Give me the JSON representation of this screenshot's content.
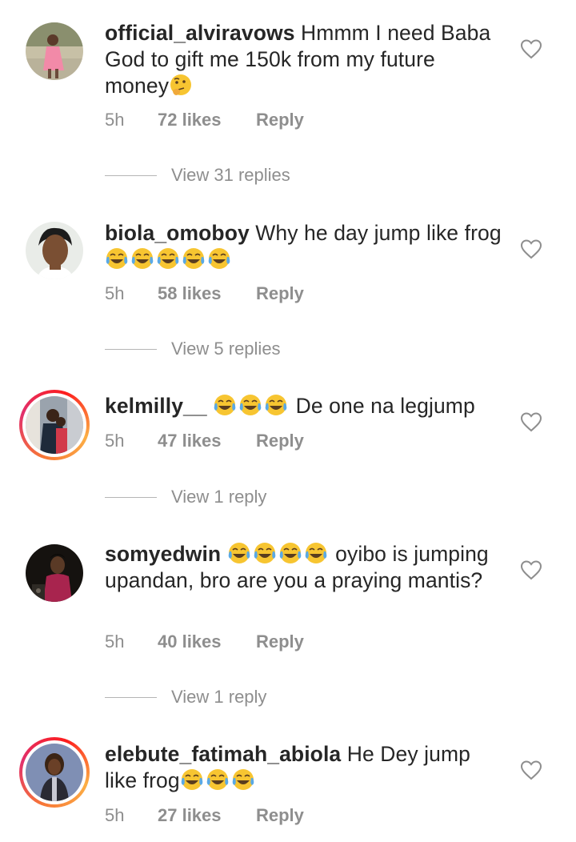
{
  "comments": [
    {
      "username": "official_alviravows",
      "text": " Hmmm I need Baba God to gift me 150k from my future money",
      "emojis": [
        "thinking-face"
      ],
      "time": "5h",
      "likes": "72 likes",
      "reply": "Reply",
      "view_replies": "View 31 replies",
      "story_ring": false
    },
    {
      "username": "biola_omoboy",
      "text": " Why he day jump like frog",
      "emojis": [
        "tears-of-joy",
        "tears-of-joy",
        "tears-of-joy",
        "tears-of-joy",
        "tears-of-joy"
      ],
      "time": "5h",
      "likes": "58 likes",
      "reply": "Reply",
      "view_replies": "View 5 replies",
      "story_ring": false
    },
    {
      "username": "kelmilly__",
      "text_after_emojis": " De one na legjump",
      "emojis": [
        "tears-of-joy",
        "tears-of-joy",
        "tears-of-joy"
      ],
      "time": "5h",
      "likes": "47 likes",
      "reply": "Reply",
      "view_replies": "View 1 reply",
      "story_ring": true
    },
    {
      "username": "somyedwin",
      "text_after_emojis": " oyibo is jumping upandan, bro are you a praying mantis?",
      "emojis": [
        "tears-of-joy",
        "tears-of-joy",
        "tears-of-joy",
        "tears-of-joy"
      ],
      "time": "5h",
      "likes": "40 likes",
      "reply": "Reply",
      "view_replies": "View 1 reply",
      "story_ring": false
    },
    {
      "username": "elebute_fatimah_abiola",
      "text": " He Dey jump like frog",
      "emojis": [
        "tears-of-joy",
        "tears-of-joy",
        "tears-of-joy"
      ],
      "time": "5h",
      "likes": "27 likes",
      "reply": "Reply",
      "story_ring": true
    }
  ],
  "icons": {
    "like": "heart-outline-icon"
  },
  "colors": {
    "text": "#262626",
    "muted": "#8e8e8e",
    "emoji_face": "#f7c531",
    "tear": "#5aa9e6"
  }
}
